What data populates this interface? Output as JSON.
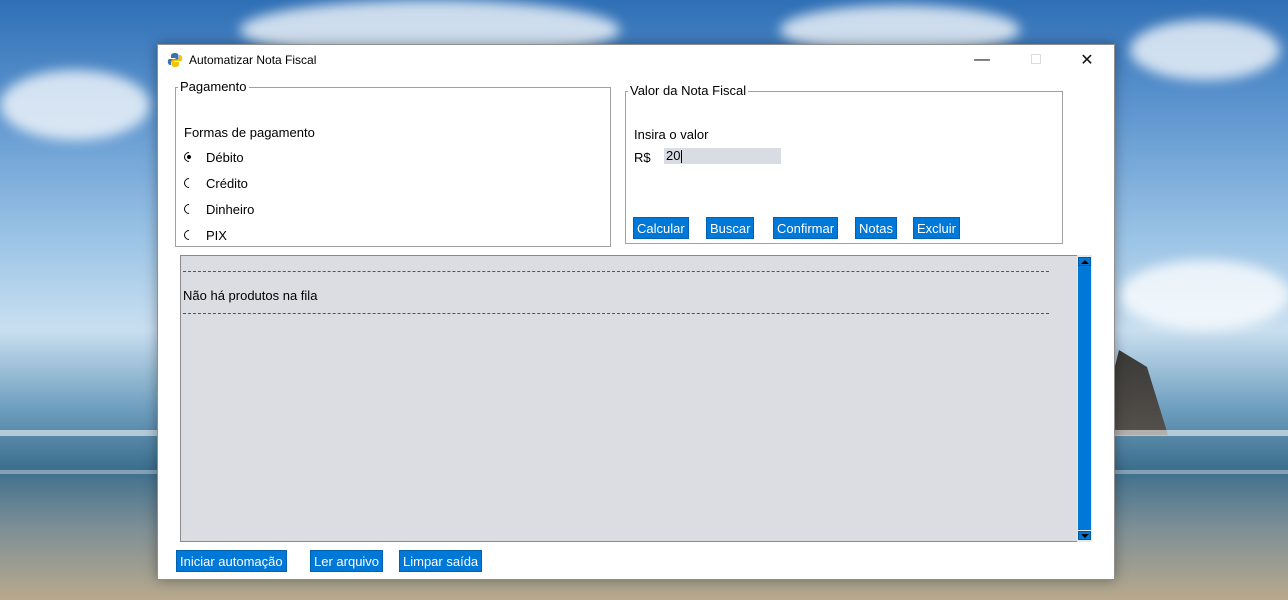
{
  "window": {
    "title": "Automatizar Nota Fiscal",
    "controls": {
      "minimize": "—",
      "maximize": "□",
      "close": "✕"
    }
  },
  "pagamento": {
    "legend": "Pagamento",
    "label": "Formas de pagamento",
    "options": [
      {
        "label": "Débito",
        "selected": true
      },
      {
        "label": "Crédito",
        "selected": false
      },
      {
        "label": "Dinheiro",
        "selected": false
      },
      {
        "label": "PIX",
        "selected": false
      }
    ]
  },
  "valor": {
    "legend": "Valor da Nota Fiscal",
    "prompt": "Insira o valor",
    "currency": "R$",
    "value": "20",
    "buttons": [
      "Calcular",
      "Buscar",
      "Confirmar",
      "Notas",
      "Excluir"
    ]
  },
  "output": {
    "message": "Não há produtos na fila"
  },
  "bottom_buttons": [
    "Iniciar automação",
    "Ler arquivo",
    "Limpar saída"
  ],
  "colors": {
    "accent": "#0078d7",
    "output_bg": "#dcdde2"
  }
}
